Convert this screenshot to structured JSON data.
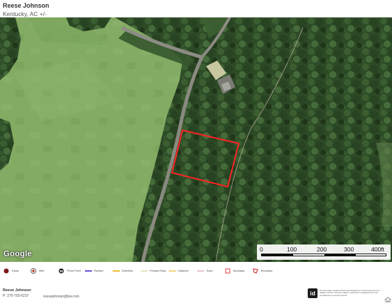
{
  "header": {
    "agent_name": "Reese Johnson",
    "location": "Kentucky,  AC +/-"
  },
  "map": {
    "attribution": "Google",
    "scale_bar": {
      "labels": [
        "0",
        "100",
        "200",
        "300",
        "400ft"
      ]
    }
  },
  "legend": {
    "items": [
      {
        "label": "Dump",
        "icon": "dump-icon",
        "color": "#7a1a1a"
      },
      {
        "label": "Well",
        "icon": "well-icon",
        "color": "#c0392b"
      },
      {
        "label": "Photo Point",
        "icon": "camera-icon",
        "color": "#111111"
      },
      {
        "label": "Pipeline",
        "icon": "pipeline-line-icon",
        "color": "#3a2bd6"
      },
      {
        "label": "Detention",
        "icon": "detention-line-icon",
        "color": "#e8a800"
      },
      {
        "label": "Primary Road",
        "icon": "primary-road-line-icon",
        "color": "#f2e6b8"
      },
      {
        "label": "Distance",
        "icon": "distance-line-icon",
        "color": "#e8a800"
      },
      {
        "label": "Trace",
        "icon": "trace-line-icon",
        "color": "#d8a8b0"
      },
      {
        "label": "Boundary",
        "icon": "boundary-square-icon",
        "color": "#e23c3c"
      },
      {
        "label": "Boundary",
        "icon": "boundary-flag-icon",
        "color": "#c01818"
      }
    ]
  },
  "footer": {
    "agent_name": "Reese Johnson",
    "phone": "P: 270-703-6237",
    "email": "reesejohnson@kw.com",
    "logo_text": "id",
    "disclaimer": "The information contained herein was obtained from sources deemed to be reliable. Land id™ Services makes no warranties or guarantees as to the completeness or accuracy thereof."
  },
  "colors": {
    "boundary": "#ff2424",
    "pasture": "#7fa85e",
    "forest": "#2f4f28",
    "road": "#8a8a80"
  }
}
